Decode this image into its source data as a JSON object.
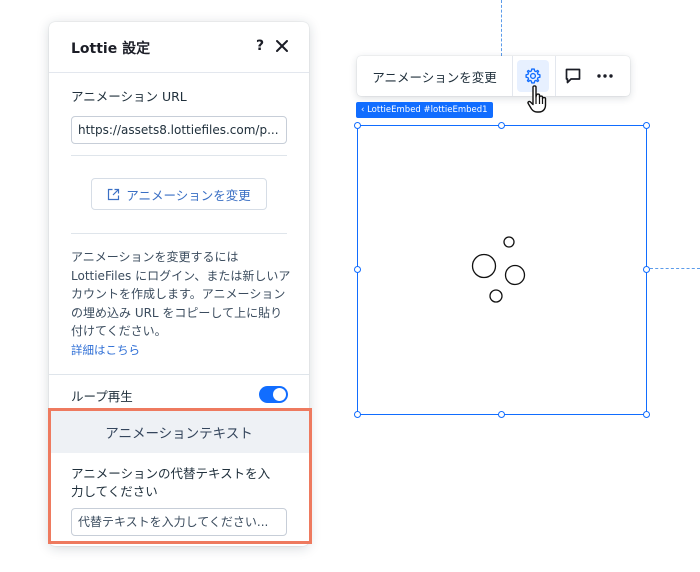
{
  "panel": {
    "title": "Lottie 設定",
    "help_label": "?",
    "url_label": "アニメーション URL",
    "url_value": "https://assets8.lottiefiles.com/p...",
    "change_button_label": "アニメーションを変更",
    "info_text": "アニメーションを変更するには LottieFiles にログイン、または新しいアカウントを作成します。アニメーションの埋め込み URL をコピーして上に貼り付けてください。",
    "learn_more": "詳細はこちら",
    "loop_label": "ループ再生",
    "loop_enabled": true,
    "alt_section_title": "アニメーションテキスト",
    "alt_label": "アニメーションの代替テキストを入力してください",
    "alt_placeholder": "代替テキストを入力してください..."
  },
  "toolbar": {
    "change_label": "アニメーションを変更",
    "icons": [
      "gear-icon",
      "comment-icon",
      "more-icon"
    ]
  },
  "canvas": {
    "component_tag": "‹ LottieEmbed #lottieEmbed1"
  },
  "colors": {
    "accent": "#116dff",
    "link": "#2f6fd6",
    "highlight": "#ee7a5f",
    "section_bg": "#eef1f5"
  }
}
